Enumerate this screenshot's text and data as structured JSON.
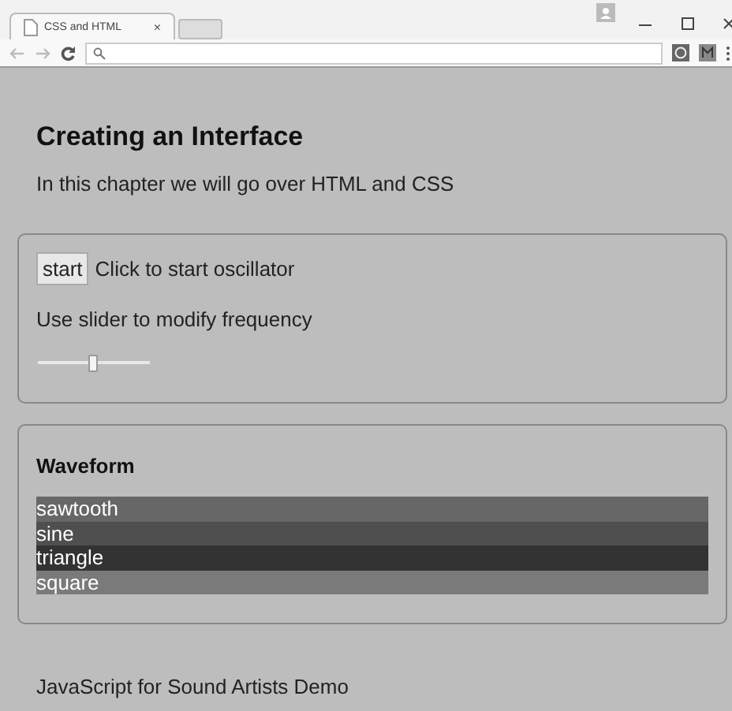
{
  "browser": {
    "tab_title": "CSS and HTML",
    "tab_close": "×"
  },
  "page": {
    "title": "Creating an Interface",
    "intro": "In this chapter we will go over HTML and CSS",
    "oscillator": {
      "button": "start",
      "hint": "Click to start oscillator",
      "slider_label": "Use slider to modify frequency",
      "slider": {
        "level": 0.49
      }
    },
    "waveform": {
      "title": "Waveform",
      "options": [
        {
          "label": "sawtooth",
          "color": "#676767"
        },
        {
          "label": "sine",
          "color": "#4f4f4f"
        },
        {
          "label": "triangle",
          "color": "#333333"
        },
        {
          "label": "square",
          "color": "#7a7a7a"
        }
      ]
    },
    "footer": "JavaScript for Sound Artists Demo"
  }
}
